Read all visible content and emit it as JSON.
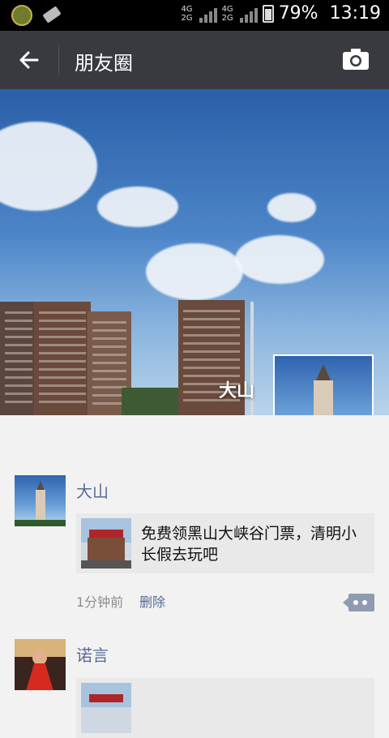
{
  "status_bar": {
    "network_1": "4G",
    "network_2": "4G",
    "network_3": "2G",
    "network_4": "2G",
    "battery": "79%",
    "time": "13:19"
  },
  "header": {
    "title": "朋友圈",
    "back_icon": "arrow-left-icon",
    "camera_icon": "camera-icon"
  },
  "cover": {
    "name": "大山"
  },
  "posts": [
    {
      "author": "大山",
      "share_text": "免费领黑山大峡谷门票，清明小长假去玩吧",
      "time": "1分钟前",
      "delete_label": "删除"
    },
    {
      "author": "诺言"
    }
  ],
  "colors": {
    "titlebar": "#393a3f",
    "author_link": "#576b95",
    "feed_bg": "#f2f2f2"
  }
}
